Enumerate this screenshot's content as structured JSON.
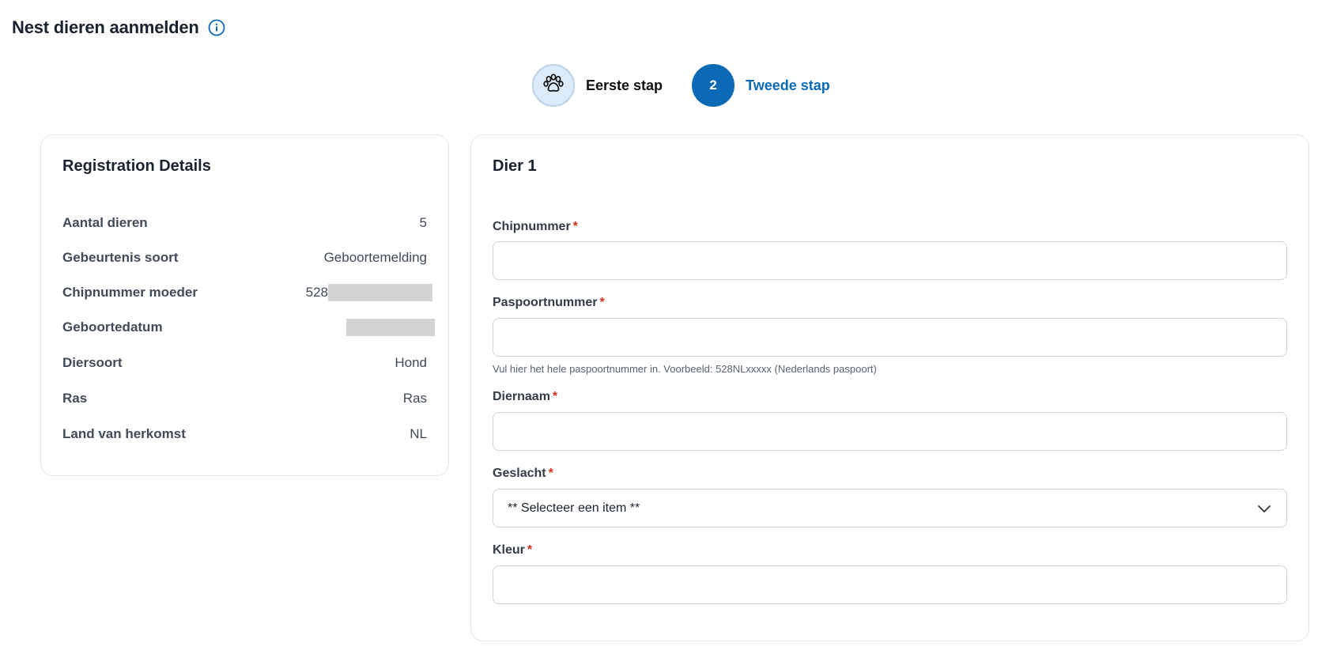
{
  "page": {
    "title": "Nest dieren aanmelden",
    "info_icon": "info-circle-icon",
    "accent_color": "#0b69b6"
  },
  "stepper": {
    "steps": [
      {
        "icon": "paw-icon",
        "label": "Eerste stap",
        "state": "completed"
      },
      {
        "number": "2",
        "label": "Tweede stap",
        "state": "active"
      }
    ]
  },
  "registration_details": {
    "title": "Registration Details",
    "rows": [
      {
        "label": "Aantal dieren",
        "value": "5"
      },
      {
        "label": "Gebeurtenis soort",
        "value": "Geboortemelding"
      },
      {
        "label": "Chipnummer moeder",
        "value": "528"
      },
      {
        "label": "Geboortedatum",
        "value": ""
      },
      {
        "label": "Diersoort",
        "value": "Hond"
      },
      {
        "label": "Ras",
        "value": "Ras"
      },
      {
        "label": "Land van herkomst",
        "value": "NL"
      }
    ]
  },
  "form": {
    "title": "Dier 1",
    "required_marker": "*",
    "fields": {
      "chipnummer": {
        "label": "Chipnummer",
        "value": ""
      },
      "paspoortnummer": {
        "label": "Paspoortnummer",
        "value": "",
        "hint": "Vul hier het hele paspoortnummer in. Voorbeeld: 528NLxxxxx (Nederlands paspoort)"
      },
      "diernaam": {
        "label": "Diernaam",
        "value": ""
      },
      "geslacht": {
        "label": "Geslacht",
        "selected": "** Selecteer een item **"
      },
      "kleur": {
        "label": "Kleur",
        "value": ""
      }
    }
  }
}
